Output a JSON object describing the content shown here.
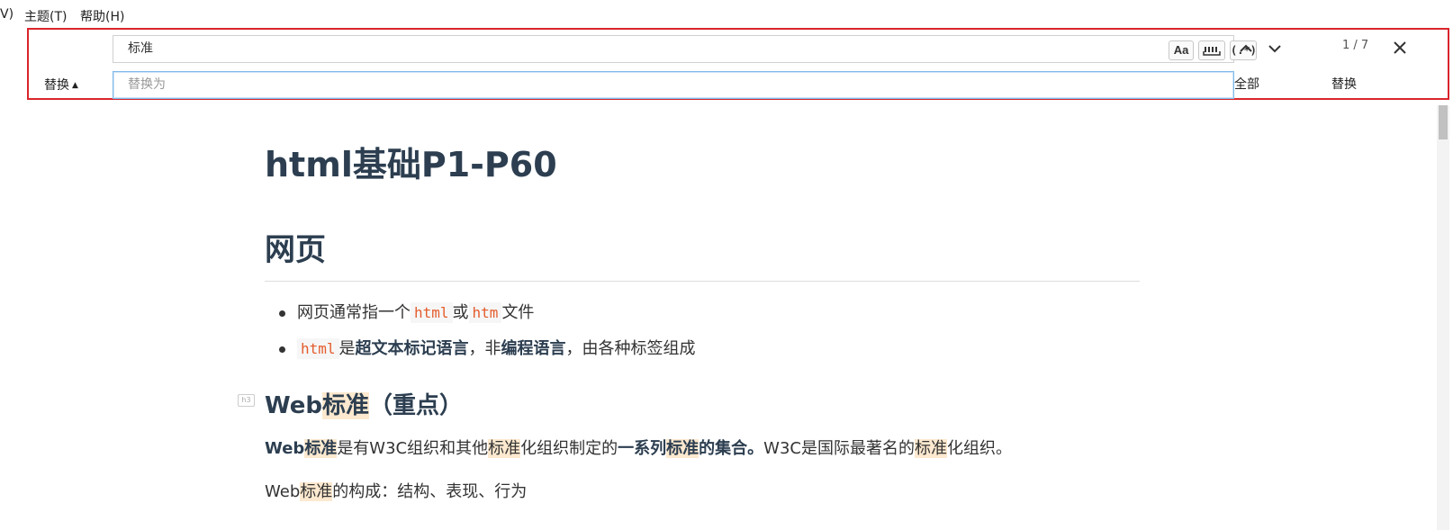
{
  "menu": {
    "partial_prev": "V)",
    "theme": "主题(T)",
    "help": "帮助(H)"
  },
  "find": {
    "query": "标准",
    "replace_placeholder": "替换为",
    "options": {
      "match_case": "Aa",
      "whole_word": "ab",
      "regex": "(.*)"
    },
    "counter": "1 / 7",
    "replace_toggle_label": "替换",
    "replace_all_label": "全部",
    "replace_label": "替换",
    "highlight_color": "#fde9cf",
    "border_color": "#d9262c"
  },
  "doc": {
    "title": "html基础P1-P60",
    "section": "网页",
    "bullets": [
      {
        "pre": "网页通常指一个",
        "code1": "html",
        "mid": "或",
        "code2": "htm",
        "post": "文件"
      },
      {
        "code": "html",
        "t1": "是",
        "b1": "超文本标记语言",
        "t2": "，非",
        "b2": "编程语言",
        "t3": "，由各种标签组成"
      }
    ],
    "h3": {
      "a": "Web",
      "hl": "标准",
      "b": "（重点）",
      "marker": "h3"
    },
    "p1": {
      "b_a": "Web",
      "b_hl": "标准",
      "t1": "是有W3C组织和其他",
      "hl1": "标准",
      "t2": "化组织制定的",
      "b2a": "一系列",
      "b2hl": "标准",
      "b2b": "的集合。",
      "t3": "W3C是国际最著名的",
      "hl2": "标准",
      "t4": "化组织。"
    },
    "p2": {
      "a": "Web",
      "hl": "标准",
      "b": "的构成：结构、表现、行为"
    }
  }
}
